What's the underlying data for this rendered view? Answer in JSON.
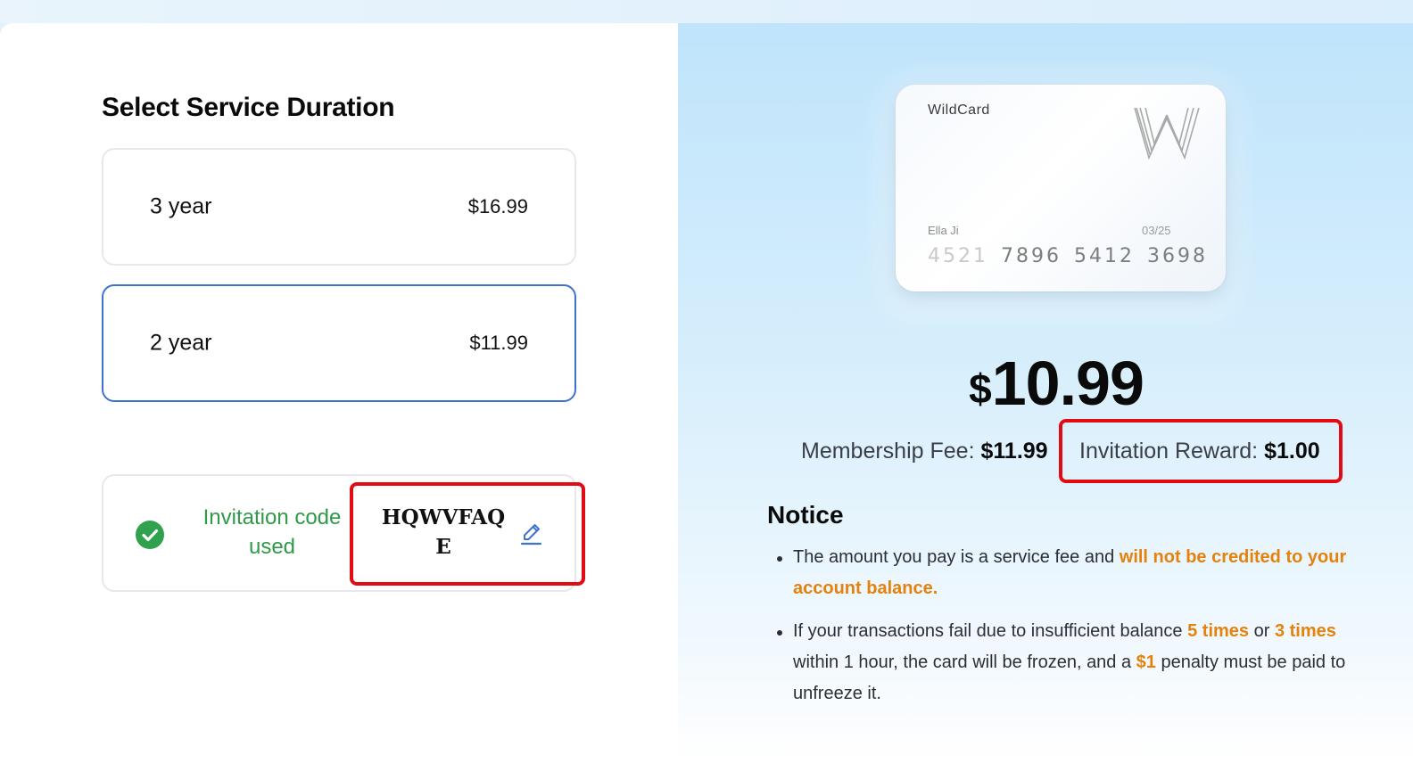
{
  "duration": {
    "title": "Select Service Duration",
    "options": [
      {
        "label": "3 year",
        "price": "$16.99",
        "selected": false
      },
      {
        "label": "2 year",
        "price": "$11.99",
        "selected": true
      }
    ]
  },
  "invitation": {
    "status": "Invitation code used",
    "code": "HQWVFAQE",
    "status_icon": "check-circle-icon",
    "edit_icon": "pencil-icon"
  },
  "card": {
    "brand": "WildCard",
    "logo": "W",
    "holder": "Ella Ji",
    "expiry": "03/25",
    "number_groups": [
      "4521",
      "7896",
      "5412",
      "3698"
    ]
  },
  "pricing": {
    "currency": "$",
    "total": "10.99",
    "membership_label": "Membership Fee:",
    "membership_value": "$11.99",
    "reward_label": "Invitation Reward:",
    "reward_value": "$1.00"
  },
  "notice": {
    "title": "Notice",
    "item1": {
      "text": "The amount you pay is a service fee and ",
      "highlight": "will not be credited to your account balance."
    },
    "item2": {
      "part1": "If your transactions fail due to insufficient balance ",
      "hl1": "5 times",
      "part2": " or ",
      "hl2": "3 times",
      "part3": " within 1 hour, the card will be frozen, and a ",
      "hl3": "$1",
      "part4": " penalty must be paid to unfreeze it."
    }
  },
  "colors": {
    "accent_blue": "#3f72cf",
    "success_green": "#2f9a48",
    "warning_orange": "#e4820b",
    "highlight_red": "#e00b13"
  }
}
